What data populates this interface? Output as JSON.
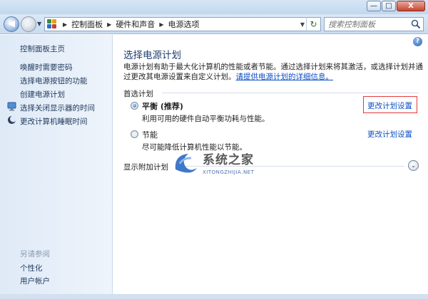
{
  "window": {
    "buttons": {
      "minimize": "—",
      "maximize": "□",
      "close": "X"
    }
  },
  "nav": {
    "back_icon": "back-arrow-icon",
    "forward_icon": "forward-arrow-icon",
    "breadcrumbs": [
      "控制面板",
      "硬件和声音",
      "电源选项"
    ],
    "search": {
      "placeholder": "搜索控制面板"
    }
  },
  "sidebar": {
    "items": [
      {
        "label": "控制面板主页"
      },
      {
        "label": "唤醒时需要密码"
      },
      {
        "label": "选择电源按钮的功能"
      },
      {
        "label": "创建电源计划"
      },
      {
        "label": "选择关闭显示器的时间",
        "icon": "monitor-icon"
      },
      {
        "label": "更改计算机睡眠时间",
        "icon": "moon-icon"
      }
    ],
    "see_also": {
      "title": "另请参阅",
      "items": [
        {
          "label": "个性化"
        },
        {
          "label": "用户帐户"
        }
      ]
    }
  },
  "main": {
    "title": "选择电源计划",
    "description": "电源计划有助于最大化计算机的性能或者节能。通过选择计划来将其激活，或选择计划并通过更改其电源设置来自定义计划。",
    "more_info_link": "请提供电源计划的详细信息。",
    "preferred_plans_title": "首选计划",
    "plans": [
      {
        "name": "平衡 (推荐)",
        "description": "利用可用的硬件自动平衡功耗与性能。",
        "selected": true,
        "change_link": "更改计划设置"
      },
      {
        "name": "节能",
        "description": "尽可能降低计算机性能以节能。",
        "selected": false,
        "change_link": "更改计划设置"
      }
    ],
    "additional_plans": "显示附加计划",
    "expand_icon": "chevron-down-icon"
  },
  "watermark": {
    "text": "系统之家",
    "subtext": "XITONGZHIJIA.NET"
  },
  "colors": {
    "link": "#0b4ec4",
    "highlight_border": "#e53b3b",
    "title": "#1e3d6e"
  }
}
